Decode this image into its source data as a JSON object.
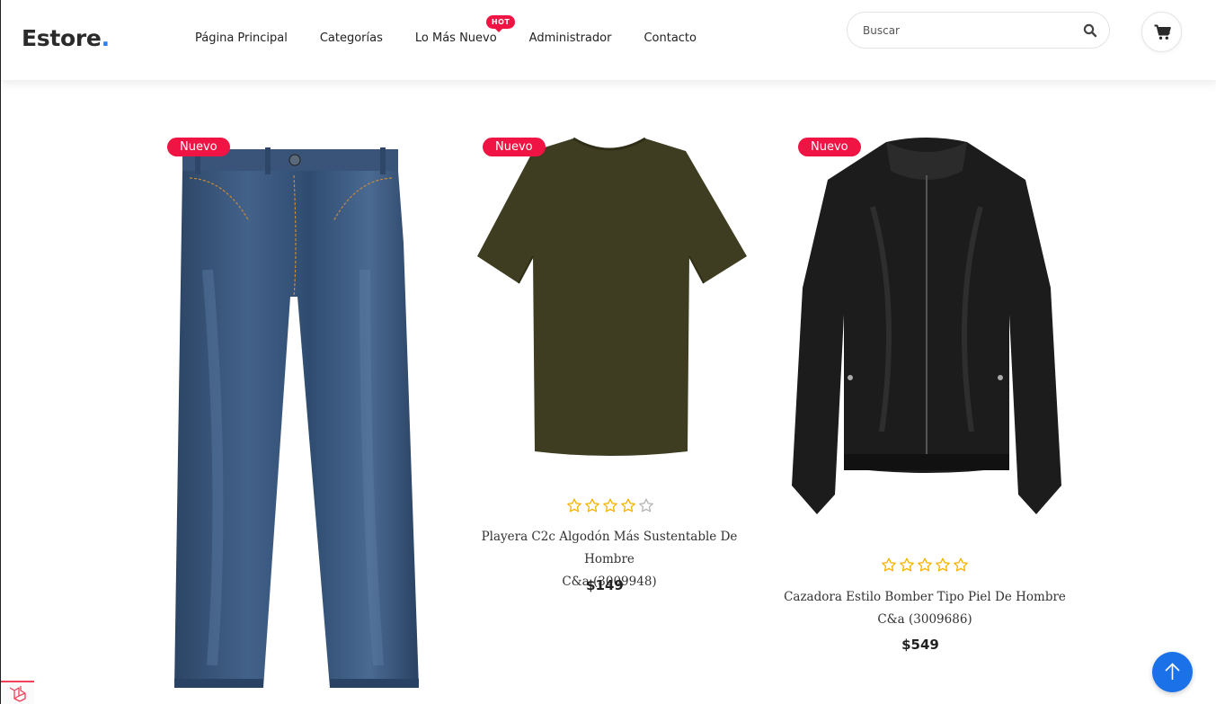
{
  "header": {
    "logo_text": "Estore",
    "logo_dot": ".",
    "nav": [
      {
        "label": "Página Principal"
      },
      {
        "label": "Categorías"
      },
      {
        "label": "Lo Más Nuevo",
        "badge": "HOT"
      },
      {
        "label": "Administrador"
      },
      {
        "label": "Contacto"
      }
    ],
    "search": {
      "placeholder": "Buscar",
      "value": ""
    },
    "icons": {
      "search": "search-icon",
      "cart": "cart-icon"
    }
  },
  "products": [
    {
      "badge": "Nuevo",
      "image": "jeans",
      "rating": null,
      "name_line1": "",
      "name_line2": "",
      "price": ""
    },
    {
      "badge": "Nuevo",
      "image": "olive-tshirt",
      "rating": 4,
      "rating_max": 5,
      "name_line1": "Playera C2c Algodón Más Sustentable De Hombre",
      "name_line2": "C&a (3009948)",
      "price": "$149"
    },
    {
      "badge": "Nuevo",
      "image": "black-bomber-jacket",
      "rating": 5,
      "rating_max": 5,
      "name_line1": "Cazadora Estilo Bomber Tipo Piel De Hombre",
      "name_line2": "C&a (3009686)",
      "price": "$549"
    }
  ],
  "colors": {
    "accent": "#ef1443",
    "brand_blue": "#2b7cf0",
    "star": "#f5b301",
    "scroll_button": "#1b72e8"
  },
  "floating": {
    "scroll_top_icon": "arrow-up-icon",
    "framework_icon": "laravel-icon"
  }
}
